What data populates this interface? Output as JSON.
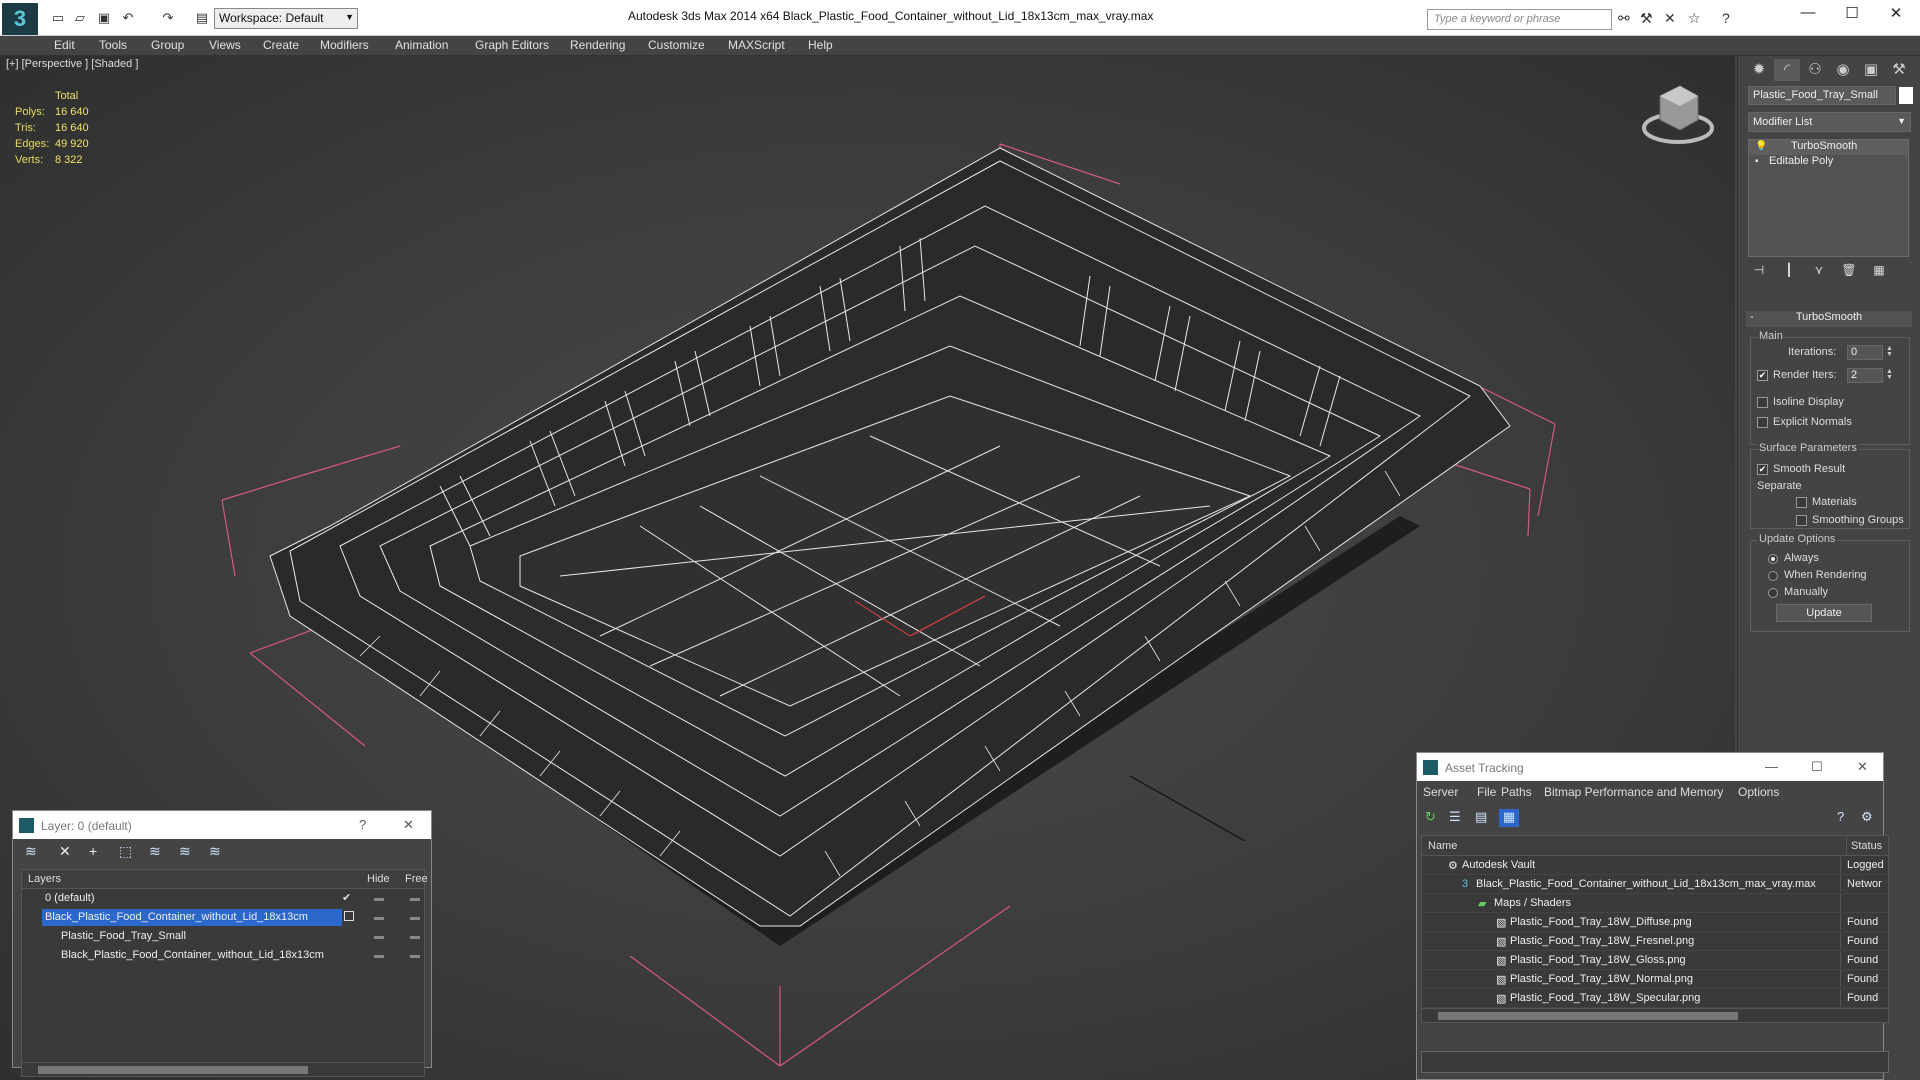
{
  "titlebar": {
    "workspace_label": "Workspace: Default",
    "title": "Autodesk 3ds Max  2014 x64      Black_Plastic_Food_Container_without_Lid_18x13cm_max_vray.max",
    "search_placeholder": "Type a keyword or phrase"
  },
  "menu": [
    "Edit",
    "Tools",
    "Group",
    "Views",
    "Create",
    "Modifiers",
    "Animation",
    "Graph Editors",
    "Rendering",
    "Customize",
    "MAXScript",
    "Help"
  ],
  "viewport": {
    "label": "[+] [Perspective ] [Shaded ]",
    "stats": {
      "total_label": "Total",
      "polys_label": "Polys:",
      "polys": "16 640",
      "tris_label": "Tris:",
      "tris": "16 640",
      "edges_label": "Edges:",
      "edges": "49 920",
      "verts_label": "Verts:",
      "verts": "8 322"
    }
  },
  "command_panel": {
    "object_name": "Plastic_Food_Tray_Small",
    "modifier_list": "Modifier List",
    "stack": [
      "TurboSmooth",
      "Editable Poly"
    ],
    "rollout_title": "TurboSmooth",
    "main_group": "Main",
    "iterations_label": "Iterations:",
    "iterations": "0",
    "render_iters_label": "Render Iters:",
    "render_iters": "2",
    "isoline_label": "Isoline Display",
    "explicit_normals_label": "Explicit Normals",
    "surface_group": "Surface Parameters",
    "smooth_result_label": "Smooth Result",
    "separate_label": "Separate",
    "materials_label": "Materials",
    "smoothing_groups_label": "Smoothing Groups",
    "update_group": "Update Options",
    "always_label": "Always",
    "when_rendering_label": "When Rendering",
    "manually_label": "Manually",
    "update_button": "Update"
  },
  "layer_window": {
    "title": "Layer: 0 (default)",
    "help": "?",
    "col_layers": "Layers",
    "col_hide": "Hide",
    "col_freeze": "Free",
    "rows": [
      {
        "name": "0 (default)"
      },
      {
        "name": "Black_Plastic_Food_Container_without_Lid_18x13cm"
      },
      {
        "name": "Plastic_Food_Tray_Small"
      },
      {
        "name": "Black_Plastic_Food_Container_without_Lid_18x13cm"
      }
    ]
  },
  "asset_window": {
    "title": "Asset Tracking",
    "menu": [
      "Server",
      "File",
      "Paths",
      "Bitmap Performance and Memory",
      "Options"
    ],
    "col_name": "Name",
    "col_status": "Status",
    "rows": [
      {
        "name": "Autodesk Vault",
        "status": "Logged"
      },
      {
        "name": "Black_Plastic_Food_Container_without_Lid_18x13cm_max_vray.max",
        "status": "Networ"
      },
      {
        "name": "Maps / Shaders",
        "status": ""
      },
      {
        "name": "Plastic_Food_Tray_18W_Diffuse.png",
        "status": "Found"
      },
      {
        "name": "Plastic_Food_Tray_18W_Fresnel.png",
        "status": "Found"
      },
      {
        "name": "Plastic_Food_Tray_18W_Gloss.png",
        "status": "Found"
      },
      {
        "name": "Plastic_Food_Tray_18W_Normal.png",
        "status": "Found"
      },
      {
        "name": "Plastic_Food_Tray_18W_Specular.png",
        "status": "Found"
      }
    ]
  },
  "colors": {
    "selection": "#2c68cc",
    "stats_text": "#f0e06a",
    "bbox": "#d45a7a",
    "wire": "#e8e8e8"
  }
}
